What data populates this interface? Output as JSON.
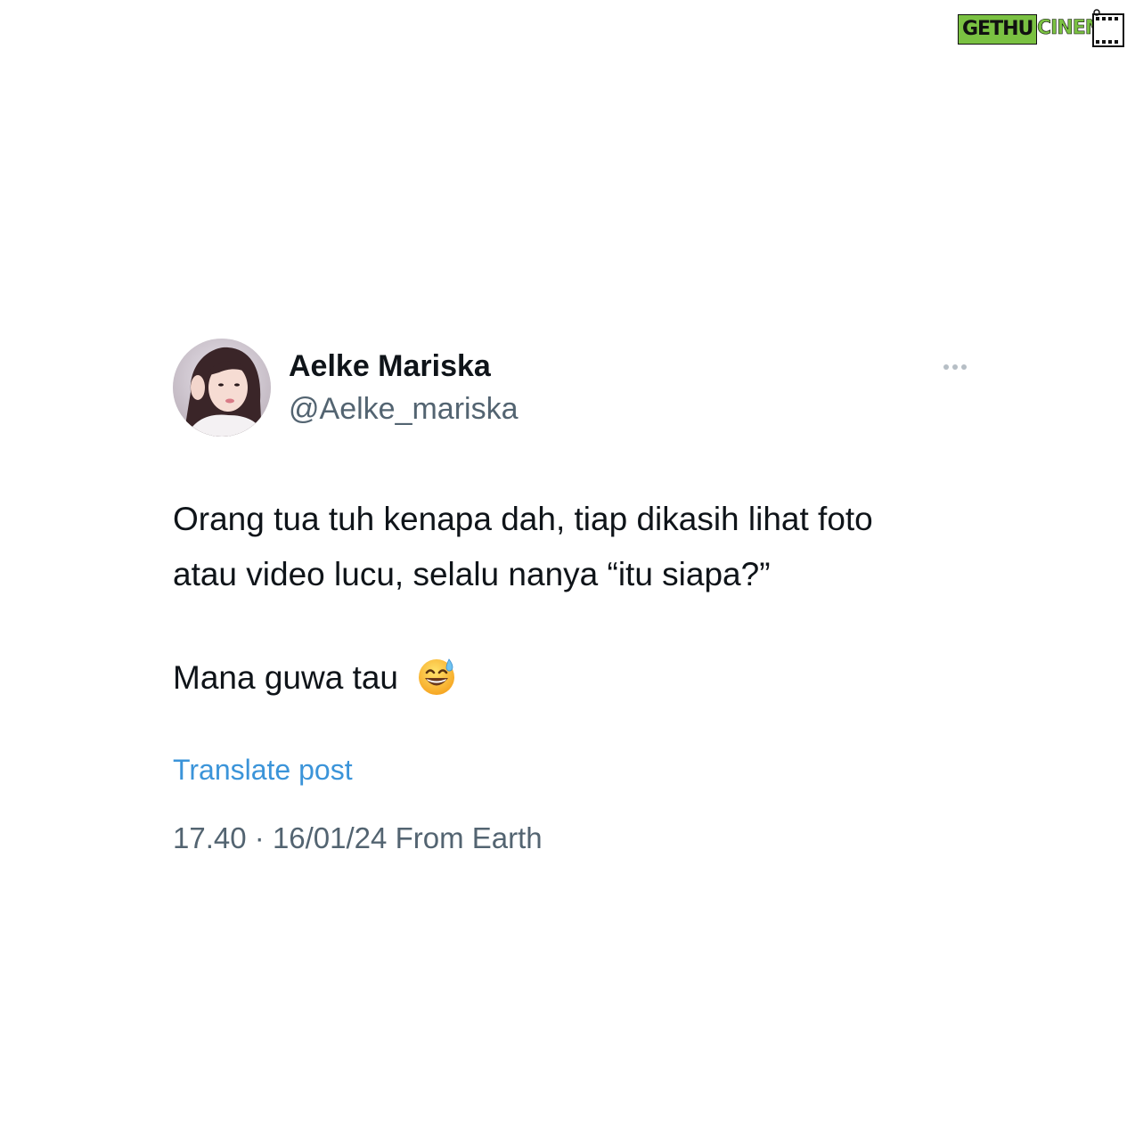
{
  "watermark": {
    "part1": "GETHU",
    "part2": "CINEMA"
  },
  "tweet": {
    "display_name": "Aelke Mariska",
    "handle": "@Aelke_mariska",
    "text_line_1": "Orang tua tuh kenapa dah, tiap dikasih lihat foto",
    "text_line_2": "atau video lucu, selalu nanya “itu siapa?”",
    "text_line_3": "Mana guwa tau",
    "emoji": "grinning-face-with-sweat",
    "translate_label": "Translate post",
    "time": "17.40",
    "separator": "·",
    "date": "16/01/24",
    "source": "From Earth"
  },
  "colors": {
    "name": "#0f1419",
    "secondary": "#536471",
    "link": "#3b94d9",
    "watermark_green": "#7ac142"
  }
}
